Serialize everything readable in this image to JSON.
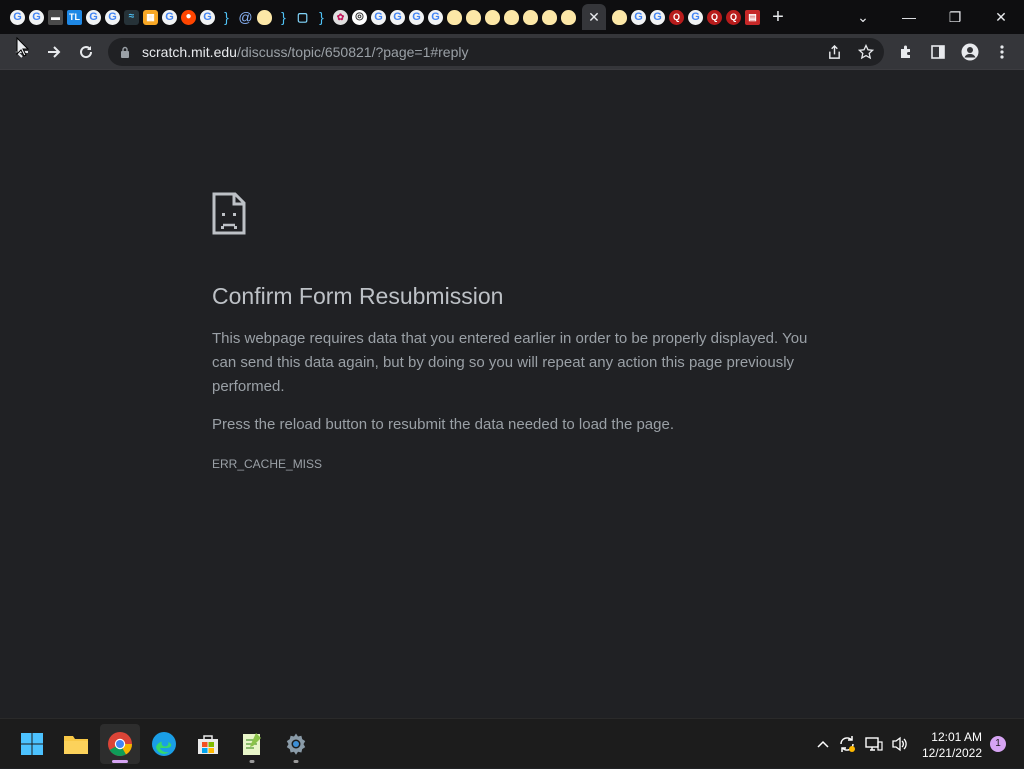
{
  "browser": {
    "tabs": [
      {
        "favicon": "google-icon",
        "glyph": "G",
        "kind": "g"
      },
      {
        "favicon": "google-icon",
        "glyph": "G",
        "kind": "g"
      },
      {
        "favicon": "monitor-icon",
        "glyph": "▬",
        "kind": "t"
      },
      {
        "favicon": "tl-icon",
        "glyph": "TL",
        "kind": "tl"
      },
      {
        "favicon": "google-icon",
        "glyph": "G",
        "kind": "g"
      },
      {
        "favicon": "google-icon",
        "glyph": "G",
        "kind": "g"
      },
      {
        "favicon": "wave-icon",
        "glyph": "≈",
        "kind": "w"
      },
      {
        "favicon": "scratch-icon",
        "glyph": "▦",
        "kind": "s"
      },
      {
        "favicon": "google-icon",
        "glyph": "G",
        "kind": "g"
      },
      {
        "favicon": "reddit-icon",
        "glyph": "●",
        "kind": "r"
      },
      {
        "favicon": "google-icon",
        "glyph": "G",
        "kind": "g"
      },
      {
        "favicon": "brace-icon",
        "glyph": "}",
        "kind": "b"
      },
      {
        "favicon": "at-icon",
        "glyph": "@",
        "kind": "a"
      },
      {
        "favicon": "egg-icon",
        "glyph": "",
        "kind": "e"
      },
      {
        "favicon": "brace-icon",
        "glyph": "}",
        "kind": "b"
      },
      {
        "favicon": "chat-icon",
        "glyph": "▢",
        "kind": "m"
      },
      {
        "favicon": "brace-icon",
        "glyph": "}",
        "kind": "b"
      },
      {
        "favicon": "puzzle-icon",
        "glyph": "✿",
        "kind": "p"
      },
      {
        "favicon": "chrome-icon",
        "glyph": "◎",
        "kind": "c"
      },
      {
        "favicon": "google-icon",
        "glyph": "G",
        "kind": "g"
      },
      {
        "favicon": "google-icon",
        "glyph": "G",
        "kind": "g"
      },
      {
        "favicon": "google-icon",
        "glyph": "G",
        "kind": "g"
      },
      {
        "favicon": "google-icon",
        "glyph": "G",
        "kind": "g"
      },
      {
        "favicon": "egg-icon",
        "glyph": "",
        "kind": "e"
      },
      {
        "favicon": "egg-icon",
        "glyph": "",
        "kind": "e"
      },
      {
        "favicon": "egg-icon",
        "glyph": "",
        "kind": "e"
      },
      {
        "favicon": "egg-icon",
        "glyph": "",
        "kind": "e"
      },
      {
        "favicon": "egg-icon",
        "glyph": "",
        "kind": "e"
      },
      {
        "favicon": "egg-icon",
        "glyph": "",
        "kind": "e"
      },
      {
        "favicon": "egg-icon",
        "glyph": "",
        "kind": "e"
      },
      {
        "favicon": "close-icon",
        "glyph": "✕",
        "kind": "active"
      },
      {
        "favicon": "egg-icon",
        "glyph": "",
        "kind": "e"
      },
      {
        "favicon": "google-icon",
        "glyph": "G",
        "kind": "g"
      },
      {
        "favicon": "google-icon",
        "glyph": "G",
        "kind": "g"
      },
      {
        "favicon": "quora-icon",
        "glyph": "Q",
        "kind": "q"
      },
      {
        "favicon": "google-icon",
        "glyph": "G",
        "kind": "g"
      },
      {
        "favicon": "quora-icon",
        "glyph": "Q",
        "kind": "q"
      },
      {
        "favicon": "quora-icon",
        "glyph": "Q",
        "kind": "q"
      },
      {
        "favicon": "book-icon",
        "glyph": "▤",
        "kind": "k"
      }
    ],
    "new_tab_glyph": "+",
    "window_controls": {
      "dropdown": "⌄",
      "minimize": "—",
      "restore": "❐",
      "close": "✕"
    },
    "address": {
      "host": "scratch.mit.edu",
      "path": "/discuss/topic/650821/?page=1#reply"
    }
  },
  "error_page": {
    "title": "Confirm Form Resubmission",
    "body": "This webpage requires data that you entered earlier in order to be properly displayed. You can send this data again, but by doing so you will repeat any action this page previously performed.",
    "reload_hint": "Press the reload button to resubmit the data needed to load the page.",
    "code": "ERR_CACHE_MISS"
  },
  "taskbar": {
    "clock_time": "12:01 AM",
    "clock_date": "12/21/2022",
    "notification_count": "1"
  }
}
